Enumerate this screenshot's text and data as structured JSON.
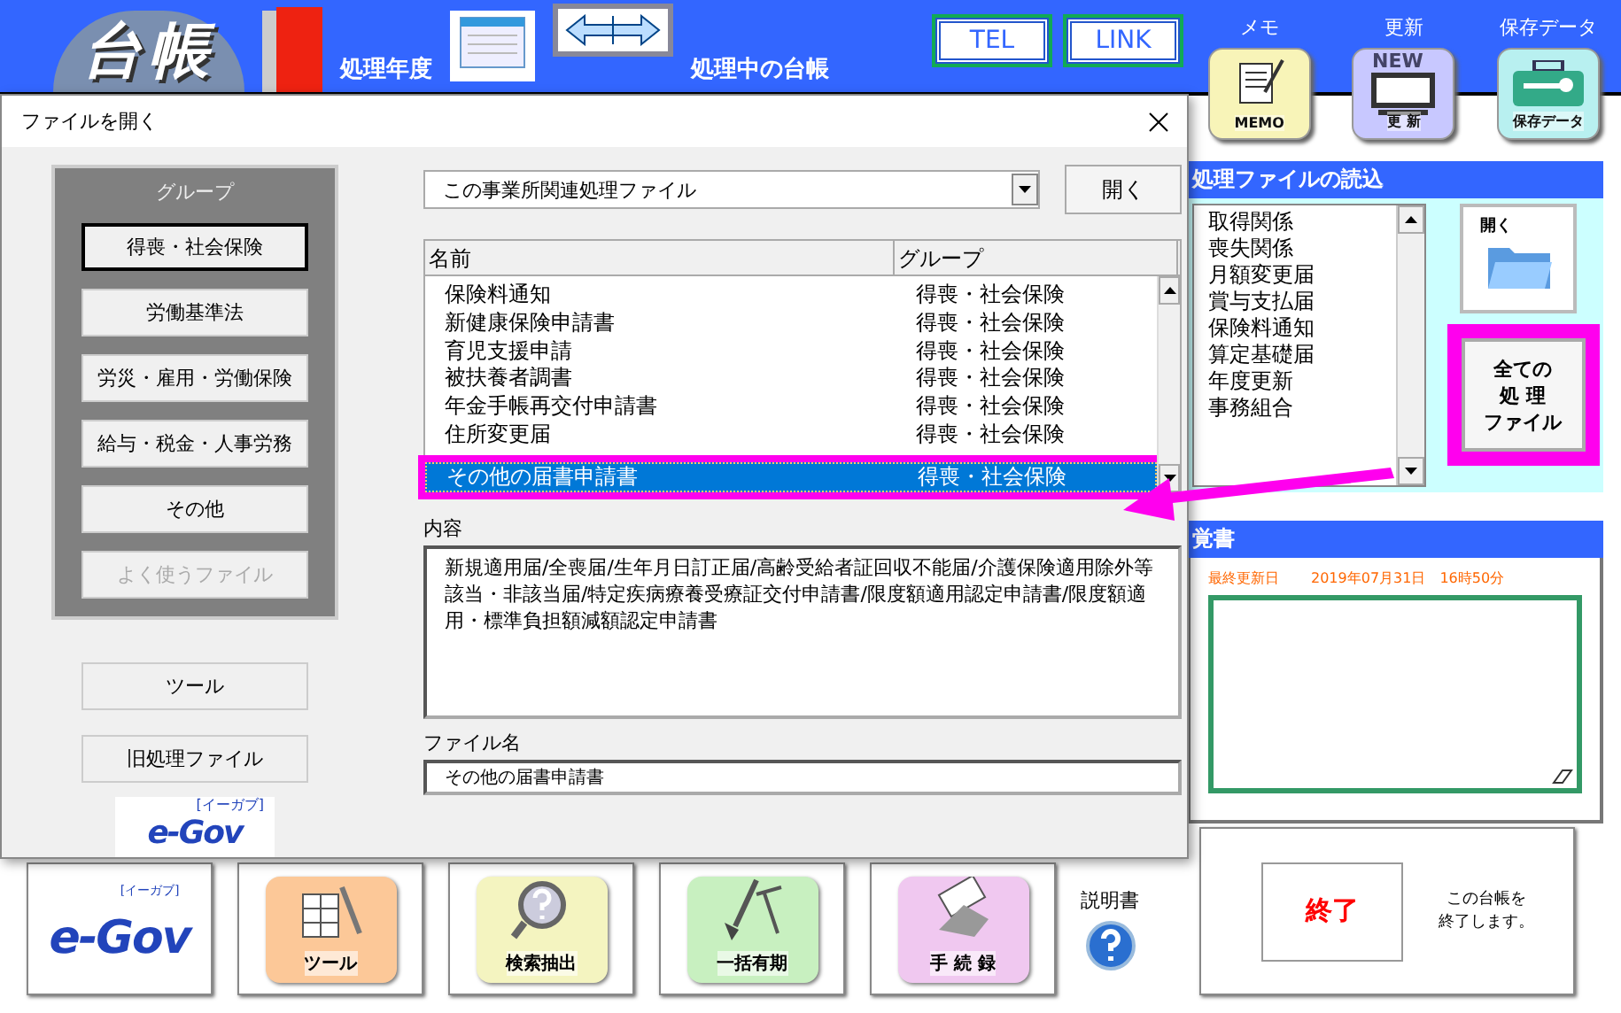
{
  "app": {
    "logo": "台帳",
    "year_label": "処理年度",
    "current_ledger_label": "処理中の台帳",
    "tel_button": "TEL",
    "link_button": "LINK",
    "tools": [
      {
        "kind": "memo",
        "caption": "メモ",
        "tile_text": "MEMO"
      },
      {
        "kind": "update",
        "caption": "更新",
        "tile_text": "更 新",
        "badge": "NEW"
      },
      {
        "kind": "save",
        "caption": "保存データ",
        "tile_text": "保存データ"
      }
    ]
  },
  "file_panel": {
    "title": "処理ファイルの読込",
    "items": [
      "取得関係",
      "喪失関係",
      "月額変更届",
      "賞与支払届",
      "保険料通知",
      "算定基礎届",
      "年度更新",
      "事務組合"
    ],
    "open_button": "開く",
    "all_files_button": [
      "全ての",
      "処 理",
      "ファイル"
    ]
  },
  "memo_panel": {
    "title": "覚書",
    "updated_label": "最終更新日",
    "updated_value": "2019年07月31日　16時50分"
  },
  "bottom_buttons": [
    {
      "kind": "egov",
      "label": "e-Gov",
      "sub": "[イーガブ]"
    },
    {
      "kind": "tool",
      "label": "ツール"
    },
    {
      "kind": "search",
      "label": "検索抽出"
    },
    {
      "kind": "bulk",
      "label": "一括有期"
    },
    {
      "kind": "records",
      "label": "手 続 録"
    }
  ],
  "manual": {
    "label": "説明書"
  },
  "exit": {
    "button": "終了",
    "note": [
      "この台帳を",
      "終了します。"
    ]
  },
  "dialog": {
    "title": "ファイルを開く",
    "group_title": "グループ",
    "groups": [
      {
        "label": "得喪・社会保険",
        "selected": true,
        "disabled": false
      },
      {
        "label": "労働基準法",
        "selected": false,
        "disabled": false
      },
      {
        "label": "労災・雇用・労働保険",
        "selected": false,
        "disabled": false
      },
      {
        "label": "給与・税金・人事労務",
        "selected": false,
        "disabled": false
      },
      {
        "label": "その他",
        "selected": false,
        "disabled": false
      },
      {
        "label": "よく使うファイル",
        "selected": false,
        "disabled": true
      }
    ],
    "tool_button": "ツール",
    "old_files_button": "旧処理ファイル",
    "egov_logo": "e-Gov",
    "egov_sub": "[イーガブ]",
    "scope": "この事業所関連処理ファイル",
    "open_button": "開く",
    "columns": [
      "名前",
      "グループ"
    ],
    "rows": [
      {
        "name": "保険料通知",
        "group": "得喪・社会保険",
        "selected": false
      },
      {
        "name": "新健康保険申請書",
        "group": "得喪・社会保険",
        "selected": false
      },
      {
        "name": "育児支援申請",
        "group": "得喪・社会保険",
        "selected": false
      },
      {
        "name": "被扶養者調書",
        "group": "得喪・社会保険",
        "selected": false
      },
      {
        "name": "年金手帳再交付申請書",
        "group": "得喪・社会保険",
        "selected": false
      },
      {
        "name": "住所変更届",
        "group": "得喪・社会保険",
        "selected": false
      },
      {
        "name": "その他の届書申請書",
        "group": "得喪・社会保険",
        "selected": true
      }
    ],
    "content_label": "内容",
    "content": "新規適用届/全喪届/生年月日訂正届/高齢受給者証回収不能届/介護保険適用除外等該当・非該当届/特定疾病療養受療証交付申請書/限度額適用認定申請書/限度額適用・標準負担額減額認定申請書",
    "filename_label": "ファイル名",
    "filename": "その他の届書申請書"
  }
}
